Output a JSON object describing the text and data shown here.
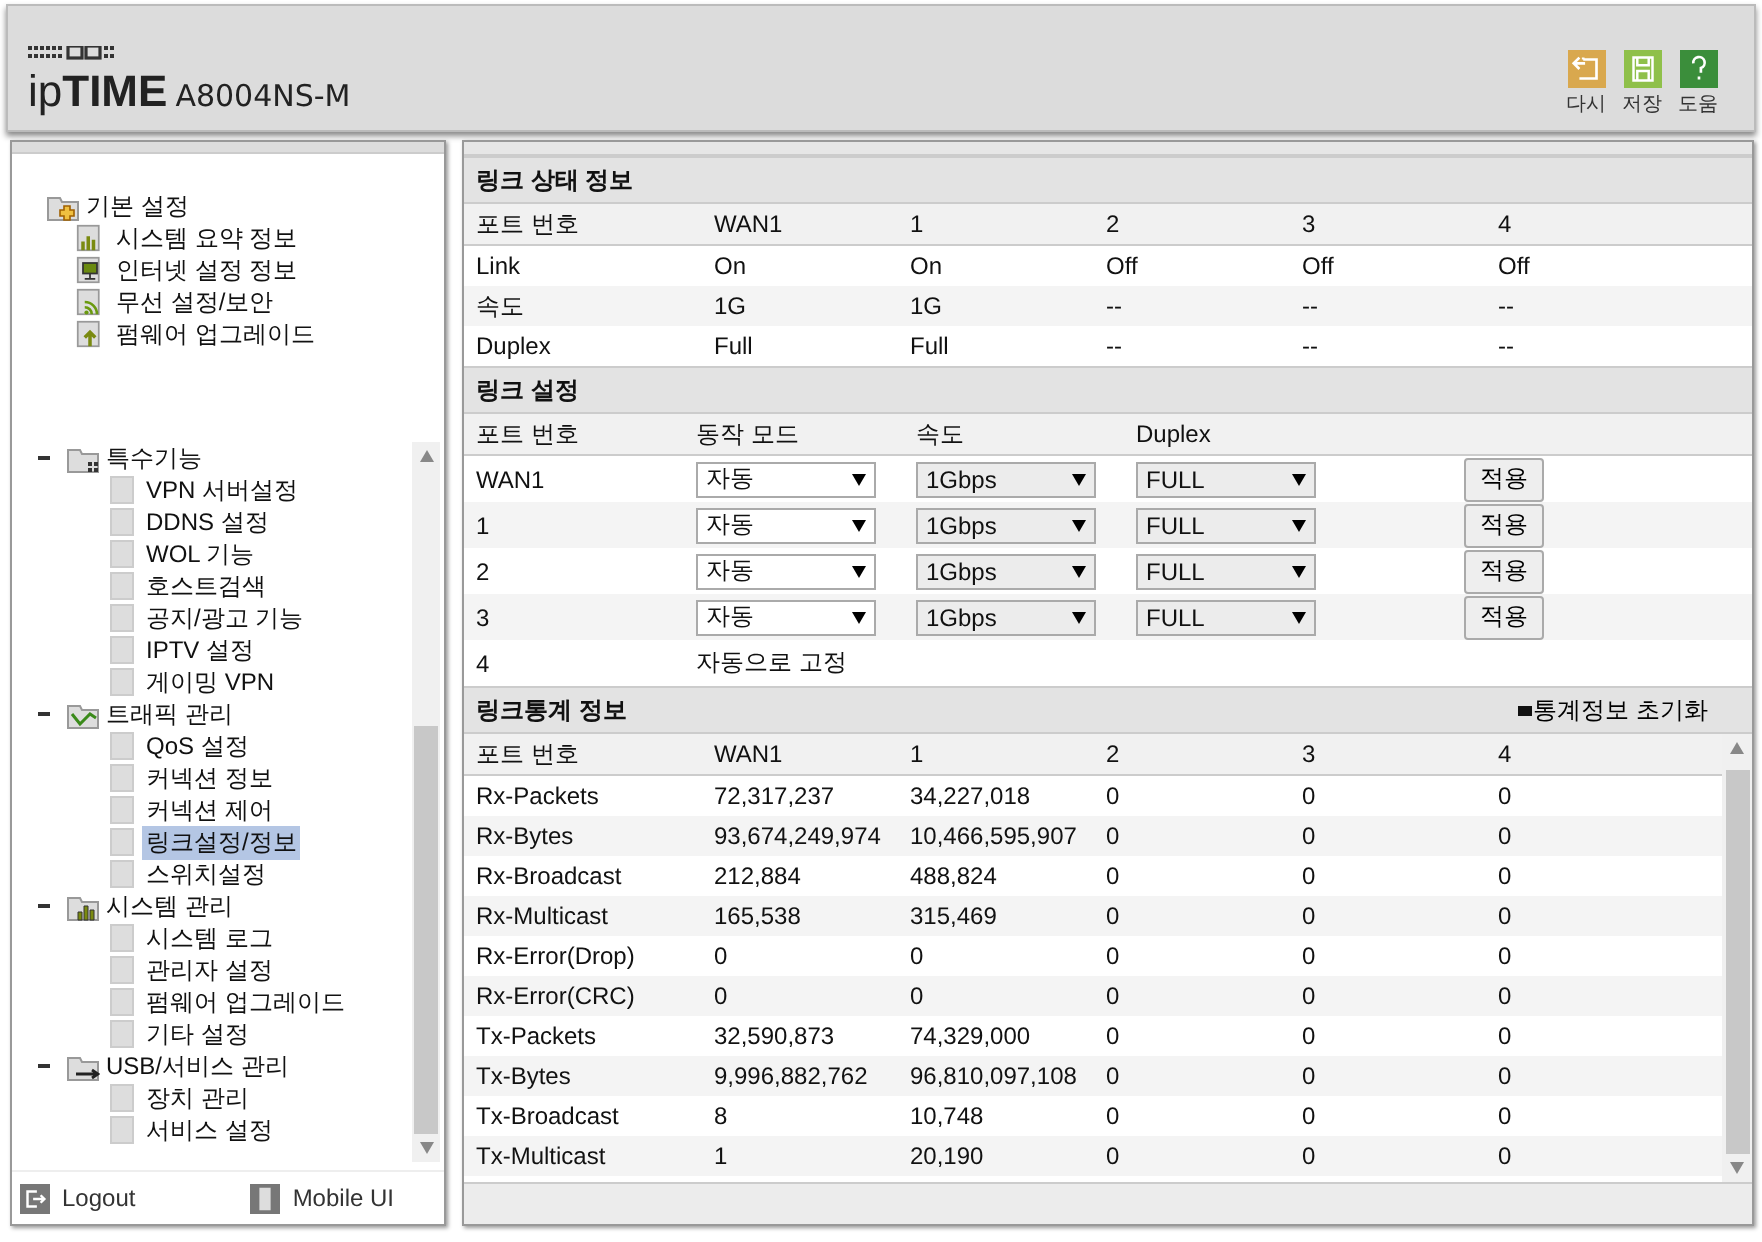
{
  "header": {
    "logo": "ip**TIME**",
    "model": "A8004NS-M",
    "buttons": [
      {
        "kind": "undo",
        "label": "다시"
      },
      {
        "kind": "save",
        "label": "저장"
      },
      {
        "kind": "help",
        "label": "도움"
      }
    ]
  },
  "sidebar": {
    "quick_menu": {
      "title": "기본 설정",
      "items": [
        {
          "kind": "chart",
          "label": "시스템 요약 정보"
        },
        {
          "kind": "monitor",
          "label": "인터넷 설정 정보"
        },
        {
          "kind": "wifi",
          "label": "무선 설정/보안"
        },
        {
          "kind": "upgrade",
          "label": "펌웨어 업그레이드"
        }
      ]
    },
    "tree": [
      {
        "kind": "special",
        "label": "특수기능",
        "expanded": true,
        "children": [
          {
            "label": "VPN 서버설정",
            "selected": false
          },
          {
            "label": "DDNS 설정",
            "selected": false
          },
          {
            "label": "WOL 기능",
            "selected": false
          },
          {
            "label": "호스트검색",
            "selected": false
          },
          {
            "label": "공지/광고 기능",
            "selected": false
          },
          {
            "label": "IPTV 설정",
            "selected": false
          },
          {
            "label": "게이밍 VPN",
            "selected": false
          }
        ]
      },
      {
        "kind": "traffic",
        "label": "트래픽 관리",
        "expanded": true,
        "children": [
          {
            "label": "QoS 설정",
            "selected": false
          },
          {
            "label": "커넥션 정보",
            "selected": false
          },
          {
            "label": "커넥션 제어",
            "selected": false
          },
          {
            "label": "링크설정/정보",
            "selected": true
          },
          {
            "label": "스위치설정",
            "selected": false
          }
        ]
      },
      {
        "kind": "system",
        "label": "시스템 관리",
        "expanded": true,
        "children": [
          {
            "label": "시스템 로그",
            "selected": false
          },
          {
            "label": "관리자 설정",
            "selected": false
          },
          {
            "label": "펌웨어 업그레이드",
            "selected": false
          },
          {
            "label": "기타 설정",
            "selected": false
          }
        ]
      },
      {
        "kind": "usb",
        "label": "USB/서비스 관리",
        "expanded": true,
        "children": [
          {
            "label": "장치 관리",
            "selected": false
          },
          {
            "label": "서비스 설정",
            "selected": false
          }
        ]
      }
    ],
    "footer": [
      {
        "kind": "logout",
        "label": "Logout"
      },
      {
        "kind": "mobile",
        "label": "Mobile UI"
      }
    ]
  },
  "link_status": {
    "title": "링크 상태 정보",
    "columns": [
      "포트 번호",
      "WAN1",
      "1",
      "2",
      "3",
      "4"
    ],
    "rows": [
      [
        "Link",
        "On",
        "On",
        "Off",
        "Off",
        "Off"
      ],
      [
        "속도",
        "1G",
        "1G",
        "--",
        "--",
        "--"
      ],
      [
        "Duplex",
        "Full",
        "Full",
        "--",
        "--",
        "--"
      ]
    ]
  },
  "link_settings": {
    "title": "링크 설정",
    "columns": [
      "포트 번호",
      "동작 모드",
      "속도",
      "Duplex"
    ],
    "rows": [
      {
        "kind": "select",
        "port": "WAN1",
        "mode": {
          "value": "자동",
          "disabled": false
        },
        "speed": {
          "value": "1Gbps",
          "disabled": true
        },
        "duplex": {
          "value": "FULL",
          "disabled": true
        },
        "button": "적용"
      },
      {
        "kind": "select",
        "port": "1",
        "mode": {
          "value": "자동",
          "disabled": false
        },
        "speed": {
          "value": "1Gbps",
          "disabled": true
        },
        "duplex": {
          "value": "FULL",
          "disabled": true
        },
        "button": "적용"
      },
      {
        "kind": "select",
        "port": "2",
        "mode": {
          "value": "자동",
          "disabled": false
        },
        "speed": {
          "value": "1Gbps",
          "disabled": true
        },
        "duplex": {
          "value": "FULL",
          "disabled": true
        },
        "button": "적용"
      },
      {
        "kind": "select",
        "port": "3",
        "mode": {
          "value": "자동",
          "disabled": false
        },
        "speed": {
          "value": "1Gbps",
          "disabled": true
        },
        "duplex": {
          "value": "FULL",
          "disabled": true
        },
        "button": "적용"
      },
      {
        "kind": "fixed",
        "port": "4",
        "text": "자동으로 고정"
      }
    ]
  },
  "link_stats": {
    "title": "링크통계 정보",
    "reset": "통계정보 초기화",
    "columns": [
      "포트 번호",
      "WAN1",
      "1",
      "2",
      "3",
      "4"
    ],
    "rows": [
      [
        "Rx-Packets",
        "72,317,237",
        "34,227,018",
        "0",
        "0",
        "0"
      ],
      [
        "Rx-Bytes",
        "93,674,249,974",
        "10,466,595,907",
        "0",
        "0",
        "0"
      ],
      [
        "Rx-Broadcast",
        "212,884",
        "488,824",
        "0",
        "0",
        "0"
      ],
      [
        "Rx-Multicast",
        "165,538",
        "315,469",
        "0",
        "0",
        "0"
      ],
      [
        "Rx-Error(Drop)",
        "0",
        "0",
        "0",
        "0",
        "0"
      ],
      [
        "Rx-Error(CRC)",
        "0",
        "0",
        "0",
        "0",
        "0"
      ],
      [
        "Tx-Packets",
        "32,590,873",
        "74,329,000",
        "0",
        "0",
        "0"
      ],
      [
        "Tx-Bytes",
        "9,996,882,762",
        "96,810,097,108",
        "0",
        "0",
        "0"
      ],
      [
        "Tx-Broadcast",
        "8",
        "10,748",
        "0",
        "0",
        "0"
      ],
      [
        "Tx-Multicast",
        "1",
        "20,190",
        "0",
        "0",
        "0"
      ]
    ]
  }
}
